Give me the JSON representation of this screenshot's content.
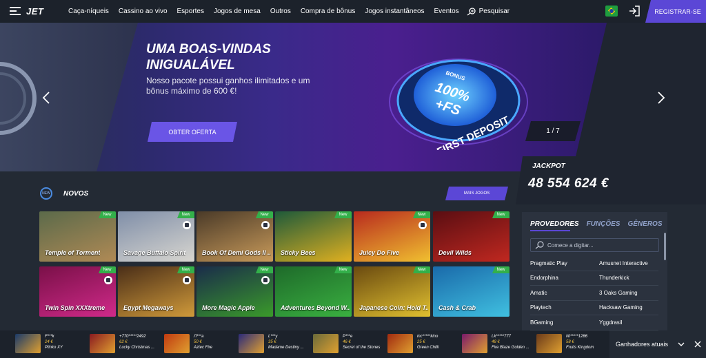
{
  "header": {
    "logo": "JET",
    "nav": [
      "Caça-níqueis",
      "Cassino ao vivo",
      "Esportes",
      "Jogos de mesa",
      "Outros",
      "Compra de bônus",
      "Jogos instantâneos",
      "Eventos"
    ],
    "search": "Pesquisar",
    "register": "REGISTRAR-SE"
  },
  "hero": {
    "title": "UMA BOAS-VINDAS INIGUALÁVEL",
    "subtitle": "Nosso pacote possui ganhos ilimitados e um bônus máximo de 600 €!",
    "cta": "OBTER OFERTA",
    "counter": "1 / 7",
    "badge": {
      "line1": "BONUS",
      "line2": "100%",
      "line3": "+FS",
      "line4": "FIRST DEPOSIT"
    }
  },
  "jackpot": {
    "label": "JACKPOT",
    "value": "48 554 624 €"
  },
  "section": {
    "title": "NOVOS",
    "more": "MAIS JOGOS",
    "icon_text": "NEW"
  },
  "games": [
    {
      "name": "Temple of Torment",
      "badge": "New",
      "colors": [
        "#5b6a4a",
        "#b08a55"
      ]
    },
    {
      "name": "Savage Buffalo Spirit",
      "badge": "New",
      "colors": [
        "#7f8ea8",
        "#d8d6d0"
      ]
    },
    {
      "name": "Book Of Demi Gods II ...",
      "badge": "New",
      "colors": [
        "#4a3a28",
        "#c89a5a"
      ]
    },
    {
      "name": "Sticky Bees",
      "badge": "New",
      "colors": [
        "#1e5a3a",
        "#e0b020"
      ]
    },
    {
      "name": "Juicy Do Five",
      "badge": "New",
      "colors": [
        "#b82a1e",
        "#f0c030"
      ]
    },
    {
      "name": "Devil Wilds",
      "badge": "New",
      "colors": [
        "#5a0e12",
        "#c02820"
      ]
    },
    {
      "name": "Twin Spin XXXtreme",
      "badge": "New",
      "colors": [
        "#7a1048",
        "#d02a8a"
      ]
    },
    {
      "name": "Egypt Megaways",
      "badge": "New",
      "colors": [
        "#4a2e18",
        "#d09a3a"
      ]
    },
    {
      "name": "More Magic Apple",
      "badge": "New",
      "colors": [
        "#1a2c4a",
        "#3a9a2a"
      ]
    },
    {
      "name": "Adventures Beyond W...",
      "badge": "New",
      "colors": [
        "#1e6a2a",
        "#3ab040"
      ]
    },
    {
      "name": "Japanese Coin: Hold T...",
      "badge": "New",
      "colors": [
        "#6a4a10",
        "#e0c030"
      ]
    },
    {
      "name": "Cash & Crab",
      "badge": "New",
      "colors": [
        "#1a6aaa",
        "#40c0e0"
      ]
    }
  ],
  "providers_panel": {
    "tabs": [
      "PROVEDORES",
      "FUNÇÕES",
      "GÊNEROS"
    ],
    "search_placeholder": "Comece a digitar...",
    "rows": [
      [
        "Pragmatic Play",
        "Amusnet Interactive"
      ],
      [
        "Endorphina",
        "Thunderkick"
      ],
      [
        "Amatic",
        "3 Oaks Gaming"
      ],
      [
        "Playtech",
        "Hacksaw Gaming"
      ],
      [
        "BGaming",
        "Yggdrasil"
      ]
    ]
  },
  "ticker": [
    {
      "user": "F***k",
      "amount": "24 €",
      "game": "Plinko XY",
      "color": "#1a3a6a"
    },
    {
      "user": "+770*****2492",
      "amount": "62 €",
      "game": "Lucky Christmas ...",
      "color": "#8a1a20"
    },
    {
      "user": "Л***а",
      "amount": "50 €",
      "game": "Aztec Fire",
      "color": "#c03a10"
    },
    {
      "user": "L***y",
      "amount": "35 €",
      "game": "Madame Destiny ...",
      "color": "#2a2a7a"
    },
    {
      "user": "P***e",
      "amount": "46 €",
      "game": "Secret of the Stones",
      "color": "#6a6a3a"
    },
    {
      "user": "inc*****kino",
      "amount": "25 €",
      "game": "Green Chilli",
      "color": "#a02a10"
    },
    {
      "user": "Lk*****777",
      "amount": "48 €",
      "game": "Fire Blaze Golden ...",
      "color": "#7a1a6a"
    },
    {
      "user": "NI*****1286",
      "amount": "58 €",
      "game": "Fruits Kingdom",
      "color": "#6a3a1a"
    }
  ],
  "winners_label": "Ganhadores atuais"
}
